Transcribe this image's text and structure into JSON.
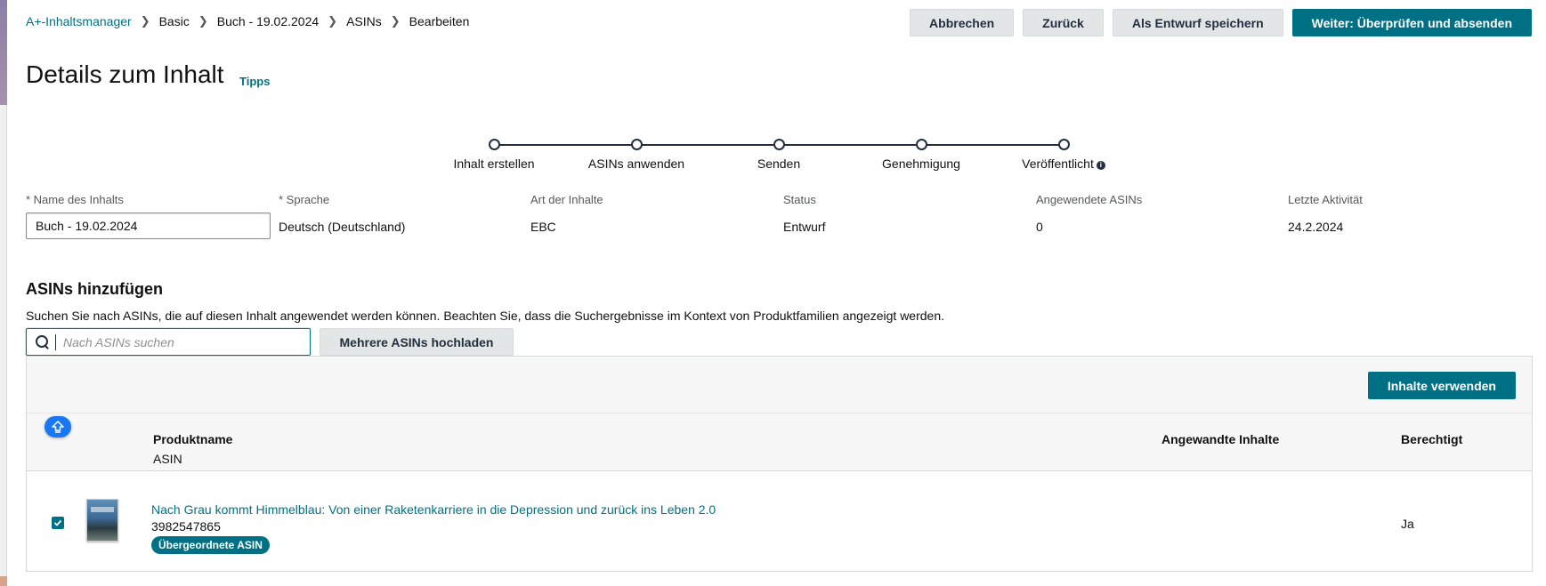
{
  "breadcrumb": [
    {
      "label": "A+-Inhaltsmanager",
      "link": true
    },
    {
      "label": "Basic",
      "link": false
    },
    {
      "label": "Buch - 19.02.2024",
      "link": false
    },
    {
      "label": "ASINs",
      "link": false
    },
    {
      "label": "Bearbeiten",
      "link": false
    }
  ],
  "actions": {
    "cancel": "Abbrechen",
    "back": "Zurück",
    "save_draft": "Als Entwurf speichern",
    "next": "Weiter: Überprüfen und absenden"
  },
  "page": {
    "title": "Details zum Inhalt",
    "tips": "Tipps"
  },
  "stepper": {
    "steps": [
      "Inhalt erstellen",
      "ASINs anwenden",
      "Senden",
      "Genehmigung",
      "Veröffentlicht"
    ],
    "info_icon": "i"
  },
  "details": {
    "name": {
      "label": "* Name des Inhalts",
      "value": "Buch - 19.02.2024"
    },
    "language": {
      "label": "* Sprache",
      "value": "Deutsch (Deutschland)"
    },
    "content_type": {
      "label": "Art der Inhalte",
      "value": "EBC"
    },
    "status": {
      "label": "Status",
      "value": "Entwurf"
    },
    "applied_asins": {
      "label": "Angewendete ASINs",
      "value": "0"
    },
    "last_activity": {
      "label": "Letzte Aktivität",
      "value": "24.2.2024"
    }
  },
  "asin_section": {
    "title": "ASINs hinzufügen",
    "description": "Suchen Sie nach ASINs, die auf diesen Inhalt angewendet werden können. Beachten Sie, dass die Suchergebnisse im Kontext von Produktfamilien angezeigt werden.",
    "search_placeholder": "Nach ASINs suchen",
    "upload_label": "Mehrere ASINs hochladen",
    "use_content_label": "Inhalte verwenden"
  },
  "table": {
    "headers": {
      "product_name": "Produktname",
      "asin": "ASIN",
      "applied_content": "Angewandte Inhalte",
      "eligible": "Berechtigt"
    },
    "rows": [
      {
        "checked": true,
        "title": "Nach Grau kommt Himmelblau: Von einer Raketenkarriere in die Depression und zurück ins Leben 2.0",
        "asin": "3982547865",
        "badge": "Übergeordnete ASIN",
        "applied_content": "",
        "eligible": "Ja"
      }
    ]
  },
  "colors": {
    "accent": "#007185",
    "secondary_button": "#e3e6e6",
    "text": "#0f1111",
    "muted": "#565959",
    "scroll_button": "#1877f2"
  }
}
